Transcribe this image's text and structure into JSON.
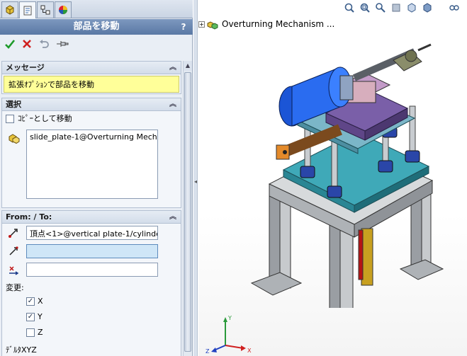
{
  "panel": {
    "title": "部品を移動",
    "help": "?",
    "tabs": [
      "feature-manager-icon",
      "property-manager-icon",
      "configuration-manager-icon",
      "appearance-icon"
    ],
    "actions": [
      "ok-check-icon",
      "cancel-x-icon",
      "undo-icon",
      "pushpin-icon"
    ]
  },
  "message": {
    "header": "メッセージ",
    "text": "拡張ｵﾌﾟｼｮﾝで部品を移動"
  },
  "selection": {
    "header": "選択",
    "copy_move_label": "ｺﾋﾟｰとして移動",
    "copy_move_checked": false,
    "items": [
      "slide_plate-1@Overturning Mechanisr"
    ]
  },
  "from_to": {
    "header": "From: / To:",
    "from_value": "頂点<1>@vertical plate-1/cylinder-1",
    "to_value": "",
    "delta_value": "",
    "change_label": "変更:",
    "axes": [
      {
        "label": "X",
        "checked": true
      },
      {
        "label": "Y",
        "checked": true
      },
      {
        "label": "Z",
        "checked": false
      }
    ],
    "delta_label": "ﾃﾞﾙﾀXYZ"
  },
  "graphics": {
    "tree_label": "Overturning Mechanism ...",
    "triad": {
      "x": "X",
      "y": "Y",
      "z": "Z"
    },
    "heads_up_icons": [
      "zoom-to-fit-icon",
      "zoom-area-icon",
      "previous-view-icon",
      "section-view-icon",
      "view-orientation-icon",
      "display-style-icon",
      "hide-show-icon"
    ]
  },
  "colors": {
    "message_bg": "#ffff99",
    "title_bar": "#5a78a4",
    "active_input": "#cfe6f7"
  }
}
